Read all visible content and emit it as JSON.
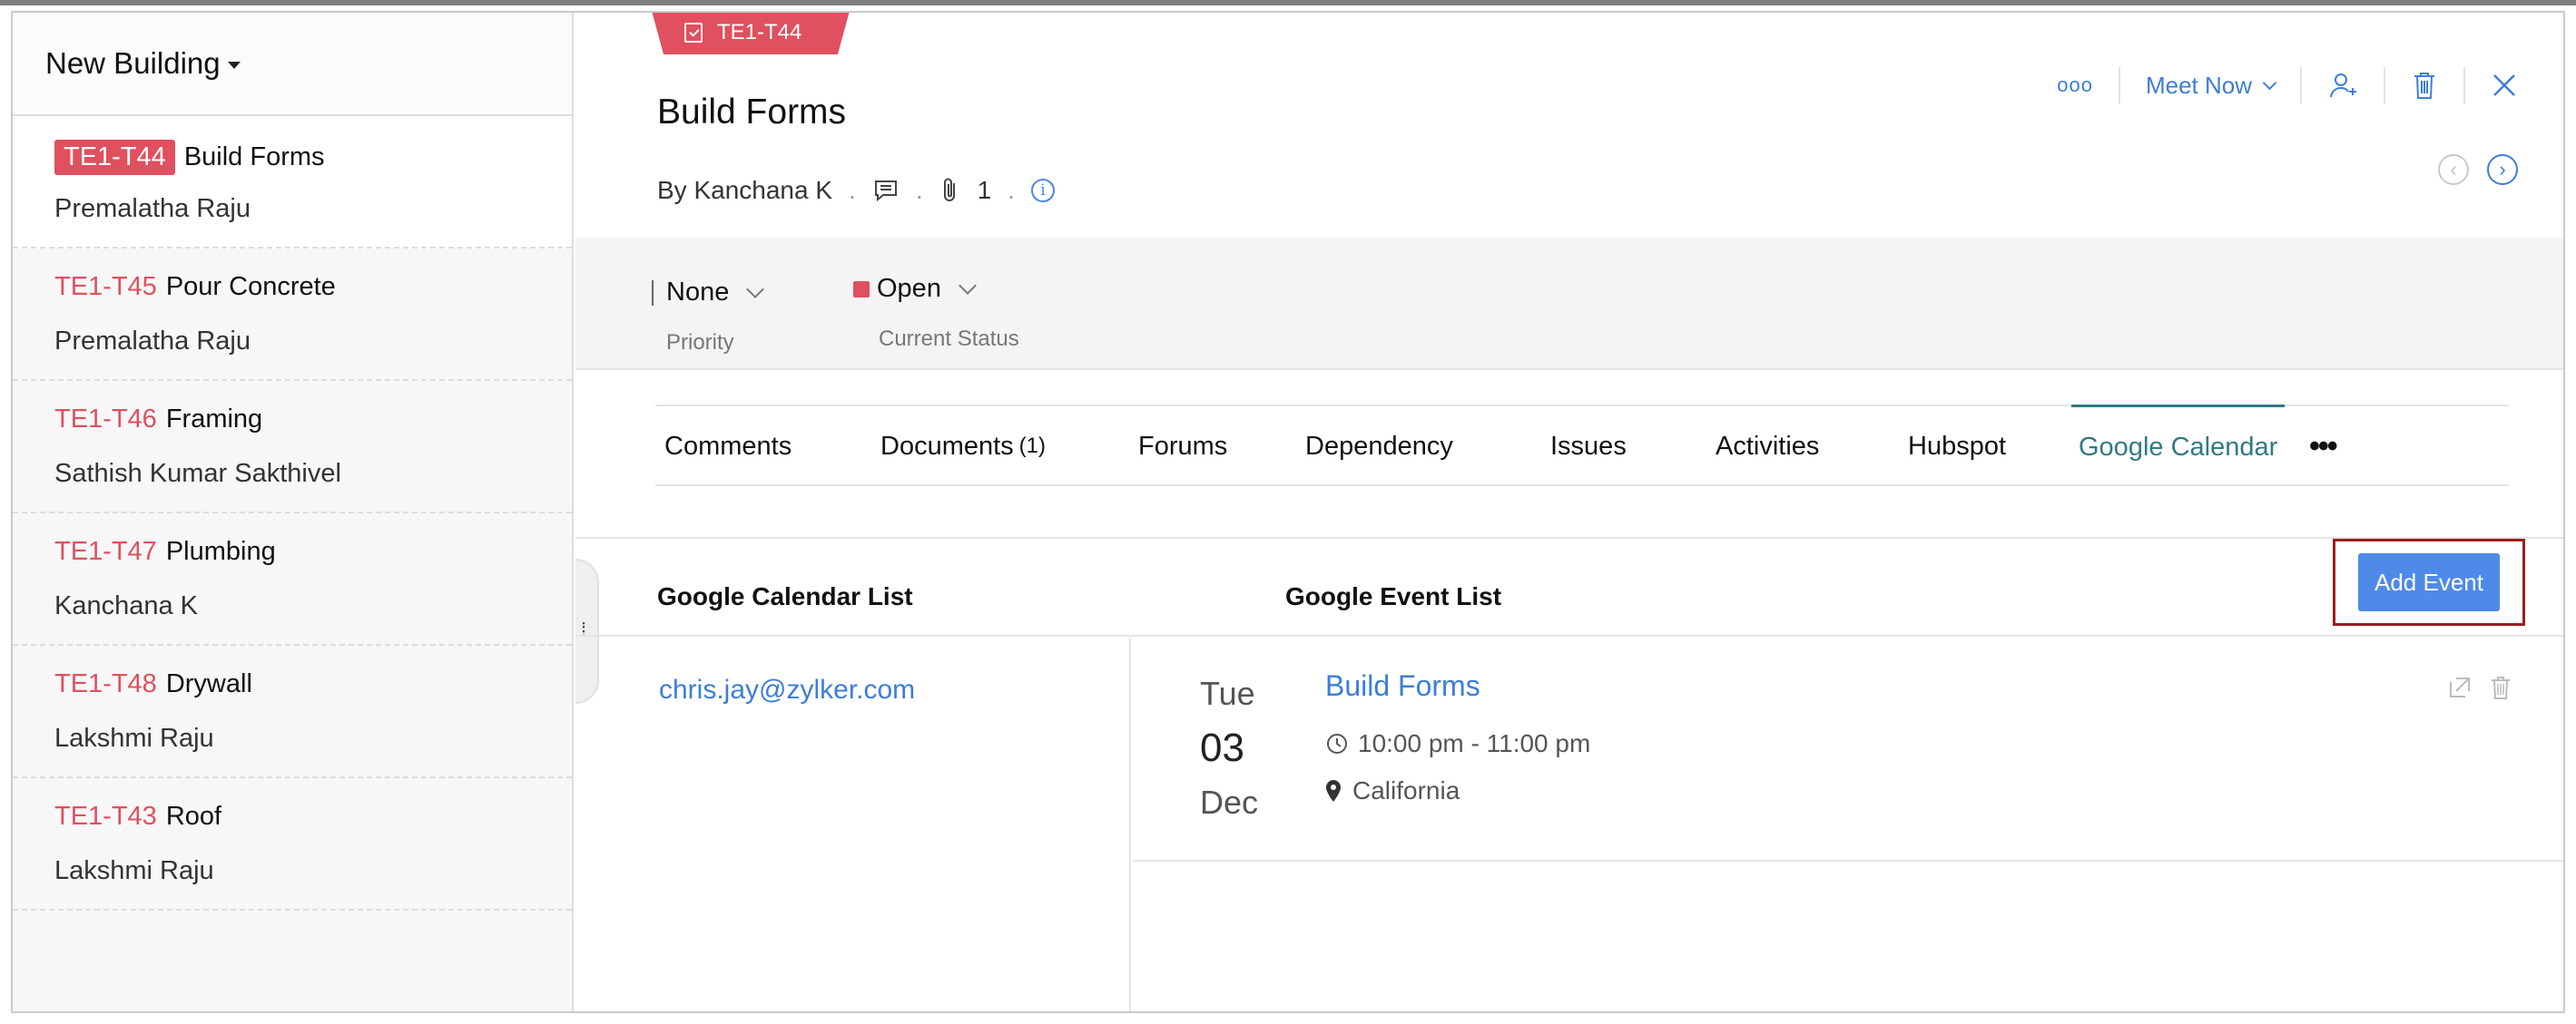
{
  "project": {
    "name": "New Building"
  },
  "tasks": [
    {
      "id": "TE1-T44",
      "title": "Build Forms",
      "owner": "Premalatha Raju"
    },
    {
      "id": "TE1-T45",
      "title": "Pour Concrete",
      "owner": "Premalatha Raju"
    },
    {
      "id": "TE1-T46",
      "title": "Framing",
      "owner": "Sathish Kumar Sakthivel"
    },
    {
      "id": "TE1-T47",
      "title": "Plumbing",
      "owner": "Kanchana  K"
    },
    {
      "id": "TE1-T48",
      "title": "Drywall",
      "owner": "Lakshmi Raju"
    },
    {
      "id": "TE1-T43",
      "title": "Roof",
      "owner": "Lakshmi Raju"
    }
  ],
  "detail": {
    "tag": "TE1-T44",
    "title": "Build Forms",
    "by": "By Kanchana  K",
    "attachments": "1",
    "priority": {
      "value": "None",
      "label": "Priority"
    },
    "status": {
      "value": "Open",
      "label": "Current Status",
      "color": "#e0505f"
    }
  },
  "actions": {
    "more": "ooo",
    "meet_now": "Meet Now"
  },
  "tabs": [
    {
      "label": "Comments"
    },
    {
      "label": "Documents",
      "count": "(1)"
    },
    {
      "label": "Forums"
    },
    {
      "label": "Dependency"
    },
    {
      "label": "Issues"
    },
    {
      "label": "Activities"
    },
    {
      "label": "Hubspot"
    },
    {
      "label": "Google Calendar"
    }
  ],
  "calendar": {
    "list_heading": "Google Calendar List",
    "event_heading": "Google Event List",
    "add_button": "Add Event",
    "account": "chris.jay@zylker.com",
    "events": [
      {
        "day": "Tue",
        "date": "03",
        "month": "Dec",
        "title": "Build Forms",
        "time": "10:00 pm - 11:00 pm",
        "location": "California"
      }
    ]
  },
  "colors": {
    "accent": "#3c7dd9",
    "tag": "#e0505f",
    "active_tab": "#2f7a84",
    "button": "#4f8ae8"
  }
}
